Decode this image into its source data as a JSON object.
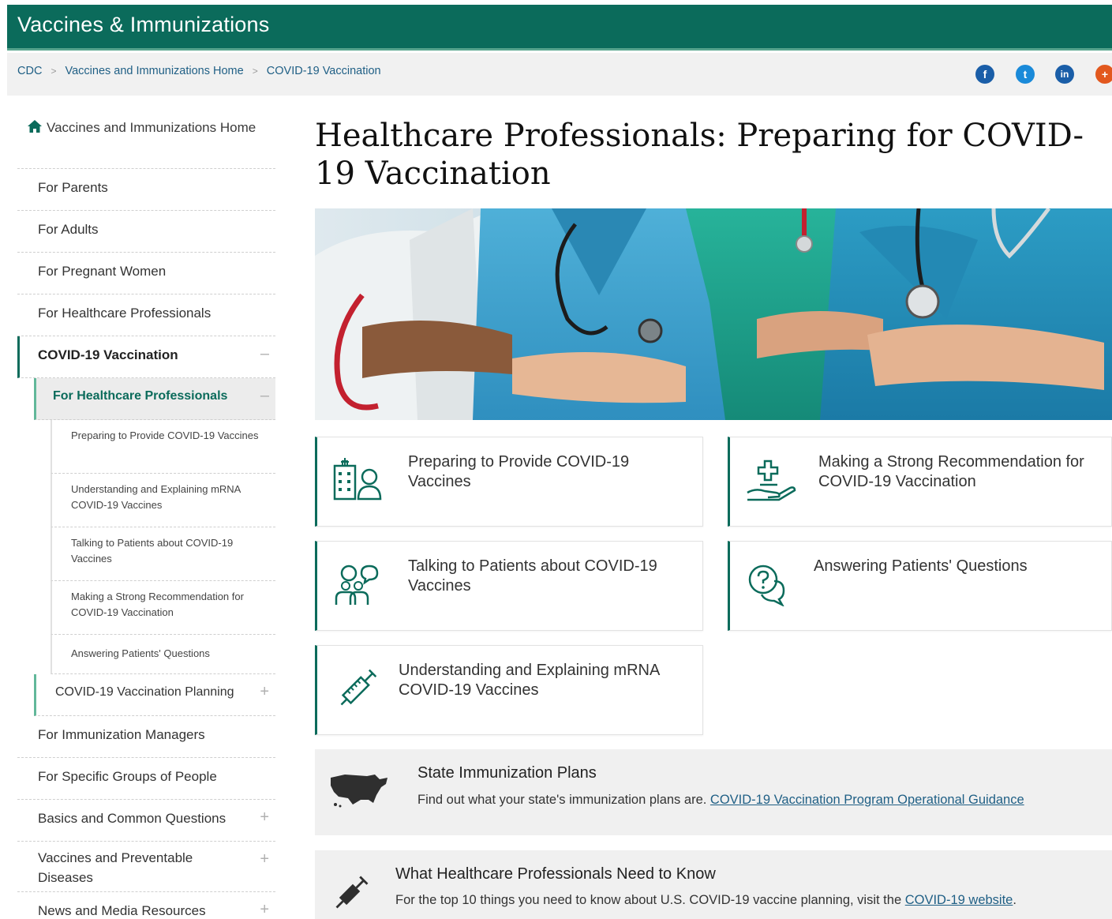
{
  "header": {
    "site_title": "Vaccines & Immunizations"
  },
  "breadcrumb": {
    "items": [
      "CDC",
      "Vaccines and Immunizations Home",
      "COVID-19 Vaccination"
    ],
    "separator": ">"
  },
  "social": {
    "icons": [
      "facebook-icon",
      "twitter-icon",
      "linkedin-icon",
      "syndicate-icon"
    ],
    "glyphs": [
      "f",
      "t",
      "in",
      "+"
    ]
  },
  "sidebar": {
    "home_label": "Vaccines and Immunizations Home",
    "items": [
      {
        "label": "For Parents"
      },
      {
        "label": "For Adults"
      },
      {
        "label": "For Pregnant Women"
      },
      {
        "label": "For Healthcare Professionals"
      },
      {
        "label": "COVID-19 Vaccination",
        "toggle": "–"
      }
    ],
    "sub": {
      "label": "For Healthcare Professionals",
      "toggle": "–"
    },
    "subsub": [
      {
        "label": "Preparing to Provide COVID-19 Vaccines"
      },
      {
        "label": "Understanding and Explaining mRNA COVID-19 Vaccines"
      },
      {
        "label": "Talking to Patients about COVID-19 Vaccines"
      },
      {
        "label": "Making a Strong Recommendation for COVID-19 Vaccination"
      },
      {
        "label": "Answering Patients' Questions"
      }
    ],
    "sub2": {
      "label": "COVID-19 Vaccination Planning",
      "toggle": "+"
    },
    "items2": [
      {
        "label": "For Immunization Managers"
      },
      {
        "label": "For Specific Groups of People"
      },
      {
        "label": "Basics and Common Questions",
        "toggle": "+"
      },
      {
        "label": "Vaccines and Preventable Diseases",
        "toggle": "+"
      },
      {
        "label": "News and Media Resources",
        "toggle": "+"
      }
    ]
  },
  "main": {
    "title": "Healthcare Professionals: Preparing for COVID-19 Vaccination",
    "cards": [
      {
        "title": "Preparing to Provide COVID-19 Vaccines",
        "icon": "hospital-patient-icon"
      },
      {
        "title": "Making a Strong Recommendation for COVID-19 Vaccination",
        "icon": "hand-cross-icon"
      },
      {
        "title": "Talking to Patients about COVID-19 Vaccines",
        "icon": "people-chat-icon"
      },
      {
        "title": "Answering Patients' Questions",
        "icon": "question-bubble-icon"
      },
      {
        "title": "Understanding and Explaining mRNA COVID-19 Vaccines",
        "icon": "syringe-icon"
      }
    ],
    "state_plans": {
      "title": "State Immunization Plans",
      "text": "Find out what your state's immunization plans are.",
      "link": "COVID-19 Vaccination Program Operational Guidance"
    },
    "need_to_know": {
      "title": "What Healthcare Professionals Need to Know",
      "text": "For the top 10 things you need to know about U.S. COVID-19 vaccine planning, visit the",
      "link": "COVID-19 website",
      "suffix": "."
    }
  },
  "colors": {
    "brand_green": "#0b6b5b",
    "accent_green": "#57a48d",
    "link_blue": "#1f5f85"
  }
}
